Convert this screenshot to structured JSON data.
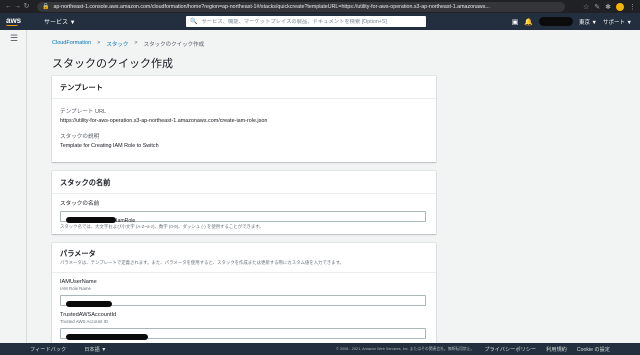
{
  "browser": {
    "url": "ap-northeast-1.console.aws.amazon.com/cloudformation/home?region=ap-northeast-1#/stacks/quickcreate?templateURL=https://utility-for-aws-operation.s3-ap-northeast-1.amazonaws..."
  },
  "header": {
    "logo": "aws",
    "services": "サービス ▼",
    "search_placeholder": "サービス、機能、マーケットプレイスの製品、ドキュメントを検索 [Option+S]",
    "region": "東京 ▼",
    "support": "サポート ▼"
  },
  "breadcrumb": {
    "items": [
      "CloudFormation",
      "スタック",
      "スタックのクイック作成"
    ],
    "separator": ">"
  },
  "page_title": "スタックのクイック作成",
  "template_panel": {
    "title": "テンプレート",
    "url_label": "テンプレート URL",
    "url_value": "https://utility-for-aws-operation.s3-ap-northeast-1.amazonaws.com/create-iam-role.json",
    "desc_label": "スタックの説明",
    "desc_value": "Template for Creating IAM Role to Switch"
  },
  "stack_name_panel": {
    "title": "スタックの名前",
    "label": "スタックの名前",
    "value_suffix": "IamRole",
    "constraint": "スタック名では、大文字および小文字 (A-Z~a-z)、数字 (0-9)、ダッシュ (-) を使用することができます。"
  },
  "params_panel": {
    "title": "パラメータ",
    "description": "パラメータは、テンプレートで定義されます。また、パラメータを使用すると、スタックを作成または更新する際にカスタム値を入力できます。",
    "params": [
      {
        "name": "IAMUserName",
        "description": "IAM Role Name"
      },
      {
        "name": "TrustedAWSAccountId",
        "description": "Trusted AWS Account ID"
      }
    ]
  },
  "footer": {
    "feedback": "フィードバック",
    "language": "日本語 ▼",
    "copyright": "© 2008 - 2021, Amazon Web Services, Inc. またはその関連会社。無断転用禁止。",
    "privacy": "プライバシーポリシー",
    "terms": "利用規約",
    "cookie": "Cookie の設定"
  },
  "colors": {
    "aws_header": "#232f3e",
    "link": "#0073bb",
    "aws_orange": "#ff9900"
  }
}
